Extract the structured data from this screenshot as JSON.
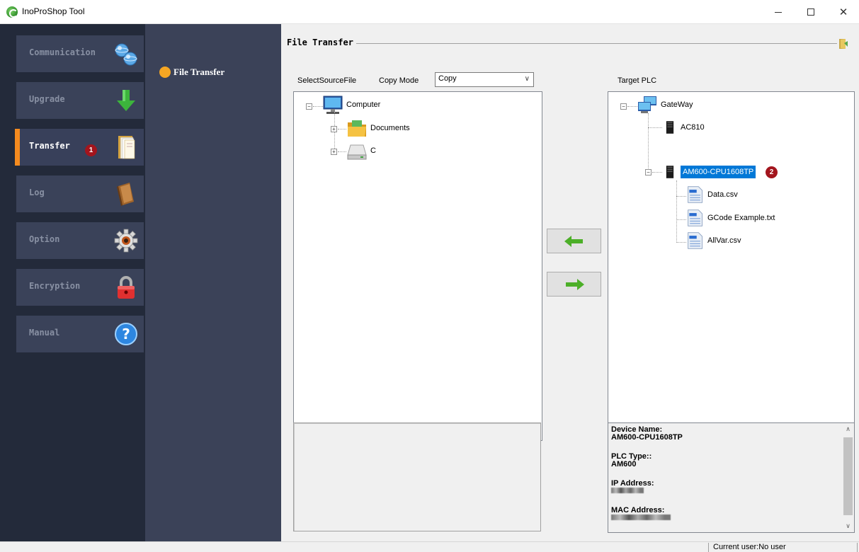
{
  "window": {
    "title": "InoProShop Tool",
    "minimize_glyph": "—",
    "close_glyph": "✕"
  },
  "nav": {
    "items": [
      {
        "label": "Communication",
        "icon": "globe-network-icon"
      },
      {
        "label": "Upgrade",
        "icon": "green-down-arrow-icon"
      },
      {
        "label": "Transfer",
        "icon": "folder-files-icon",
        "active": true,
        "badge": "1"
      },
      {
        "label": "Log",
        "icon": "log-book-icon"
      },
      {
        "label": "Option",
        "icon": "gear-icon"
      },
      {
        "label": "Encryption",
        "icon": "lock-icon"
      },
      {
        "label": "Manual",
        "icon": "help-icon"
      }
    ]
  },
  "subnav": {
    "items": [
      {
        "label": "File Transfer"
      }
    ]
  },
  "main": {
    "section_title": "File Transfer",
    "source_label": "SelectSourceFile",
    "copy_mode_label": "Copy Mode",
    "copy_mode_value": "Copy",
    "target_label": "Target PLC",
    "source_tree": {
      "root": "Computer",
      "children": [
        "Documents",
        "C"
      ]
    },
    "target_tree": {
      "root": "GateWay",
      "devices": [
        "AC810",
        "AM600-CPU1608TP"
      ],
      "selected_device": "AM600-CPU1608TP",
      "selected_badge": "2",
      "files": [
        "Data.csv",
        "GCode Example.txt",
        "AllVar.csv"
      ]
    },
    "buttons": {
      "to_source": "left-arrow-icon",
      "to_target": "right-arrow-icon"
    },
    "device_info": {
      "device_name_label": "Device Name:",
      "device_name": "AM600-CPU1608TP",
      "plc_type_label": "PLC Type::",
      "plc_type": "AM600",
      "ip_label": "IP Address:",
      "mac_label": "MAC Address:"
    }
  },
  "status": {
    "current_user": "Current user:No user"
  },
  "colors": {
    "nav_bg": "#232a3a",
    "nav_item": "#3a4259",
    "subnav_bg": "#3b4258",
    "accent": "#f58b1f",
    "badge": "#a3151d",
    "selection": "#0078d7"
  }
}
